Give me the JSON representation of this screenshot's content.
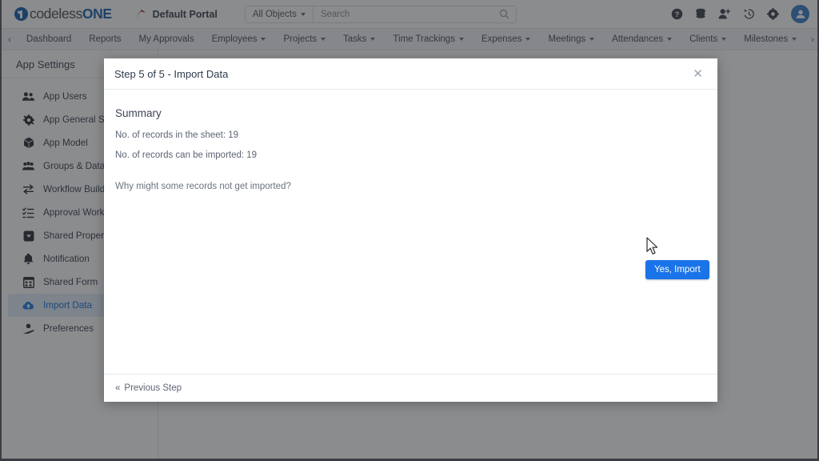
{
  "app": {
    "logo_primary": "codeless",
    "logo_secondary": "ONE",
    "portal_name": "Default Portal",
    "accent_color": "#1a73e8",
    "logo_blue": "#1c63b3",
    "portal_icon_color": "#a01b1b"
  },
  "search": {
    "object_filter": "All Objects",
    "placeholder": "Search",
    "value": "",
    "search_icon": "search-icon",
    "dropdown_icon": "chevron-down-icon"
  },
  "top_icons": [
    {
      "name": "help-icon",
      "glyph": "?"
    },
    {
      "name": "database-icon",
      "glyph": ""
    },
    {
      "name": "add-user-icon",
      "glyph": ""
    },
    {
      "name": "history-icon",
      "glyph": ""
    },
    {
      "name": "settings-gear-icon",
      "glyph": ""
    },
    {
      "name": "user-avatar",
      "glyph": ""
    }
  ],
  "nav": {
    "scroll_left_icon": "chevron-left-icon",
    "scroll_right_icon": "chevron-right-icon",
    "items": [
      {
        "label": "Dashboard",
        "has_dropdown": false
      },
      {
        "label": "Reports",
        "has_dropdown": false
      },
      {
        "label": "My Approvals",
        "has_dropdown": false
      },
      {
        "label": "Employees",
        "has_dropdown": true
      },
      {
        "label": "Projects",
        "has_dropdown": true
      },
      {
        "label": "Tasks",
        "has_dropdown": true
      },
      {
        "label": "Time Trackings",
        "has_dropdown": true
      },
      {
        "label": "Expenses",
        "has_dropdown": true
      },
      {
        "label": "Meetings",
        "has_dropdown": true
      },
      {
        "label": "Attendances",
        "has_dropdown": true
      },
      {
        "label": "Clients",
        "has_dropdown": true
      },
      {
        "label": "Milestones",
        "has_dropdown": true
      }
    ]
  },
  "sidebar": {
    "title": "App Settings",
    "items": [
      {
        "label": "App Users",
        "icon": "users-icon",
        "active": false
      },
      {
        "label": "App General Settings",
        "icon": "gear-icon",
        "active": false
      },
      {
        "label": "App Model",
        "icon": "cube-icon",
        "active": false
      },
      {
        "label": "Groups & Data Access",
        "icon": "group-users-icon",
        "active": false
      },
      {
        "label": "Workflow Builder",
        "icon": "workflow-arrows-icon",
        "active": false
      },
      {
        "label": "Approval Workflows",
        "icon": "checklist-icon",
        "active": false
      },
      {
        "label": "Shared Property",
        "icon": "shared-property-icon",
        "active": false
      },
      {
        "label": "Notification",
        "icon": "bell-icon",
        "active": false
      },
      {
        "label": "Shared Form",
        "icon": "form-icon",
        "active": false
      },
      {
        "label": "Import Data",
        "icon": "cloud-upload-icon",
        "active": true
      },
      {
        "label": "Preferences",
        "icon": "preferences-icon",
        "active": false
      }
    ]
  },
  "modal": {
    "title": "Step 5 of 5 - Import Data",
    "close_icon": "close-icon",
    "summary_heading": "Summary",
    "lines": [
      "No. of records in the sheet: 19",
      "No. of records can be imported: 19"
    ],
    "help_link": "Why might some records not get imported?",
    "import_button": "Yes, Import",
    "previous_step": "Previous Step",
    "previous_step_icon": "double-chevron-left-icon"
  }
}
